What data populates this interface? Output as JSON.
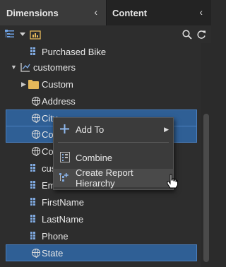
{
  "tabs": [
    {
      "label": "Dimensions",
      "collapse_icon": "chevron-left-icon"
    },
    {
      "label": "Content",
      "collapse_icon": "chevron-left-icon"
    }
  ],
  "toolbar": {
    "icons": [
      "tree-view-icon",
      "dropdown-arrow-icon",
      "report-chart-icon",
      "search-icon",
      "refresh-icon"
    ]
  },
  "tree": {
    "items": [
      {
        "label": "Purchased Bike",
        "icon": "attribute-icon",
        "selected": false
      },
      {
        "label": "customers",
        "icon": "hierarchy-icon",
        "expanded": true,
        "selected": false
      },
      {
        "label": "Custom",
        "icon": "folder-icon",
        "selected": false
      },
      {
        "label": "Address",
        "icon": "geo-attribute-icon",
        "selected": false
      },
      {
        "label": "City",
        "icon": "geo-attribute-icon",
        "selected": true
      },
      {
        "label": "Co",
        "icon": "geo-attribute-icon",
        "selected": true
      },
      {
        "label": "Co",
        "icon": "geo-attribute-icon",
        "selected": false
      },
      {
        "label": "cus",
        "icon": "attribute-icon",
        "selected": false
      },
      {
        "label": "Email",
        "icon": "attribute-icon",
        "selected": false
      },
      {
        "label": "FirstName",
        "icon": "attribute-icon",
        "selected": false
      },
      {
        "label": "LastName",
        "icon": "attribute-icon",
        "selected": false
      },
      {
        "label": "Phone",
        "icon": "attribute-icon",
        "selected": false
      },
      {
        "label": "State",
        "icon": "geo-attribute-icon",
        "selected": true
      }
    ]
  },
  "context_menu": {
    "items": [
      {
        "label": "Add To",
        "icon": "plus-icon",
        "has_submenu": true
      },
      {
        "label": "Combine",
        "icon": "combine-icon"
      },
      {
        "label": "Create Report Hierarchy",
        "icon": "create-hierarchy-icon",
        "hovered": true
      }
    ]
  },
  "colors": {
    "selection": "#2f5f95",
    "accent": "#7fa9e0",
    "folder": "#e5b85a"
  }
}
